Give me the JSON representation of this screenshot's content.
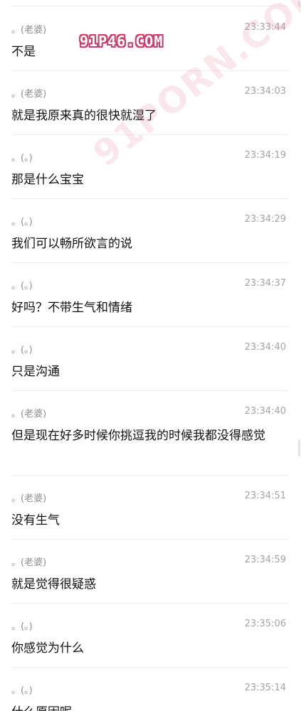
{
  "messages": [
    {
      "sender": "。(老婆)",
      "time": "23:33:44",
      "text": "不是"
    },
    {
      "sender": "。(老婆)",
      "time": "23:34:03",
      "text": "就是我原来真的很快就湿了"
    },
    {
      "sender": "。(。)",
      "time": "23:34:19",
      "text": "那是什么宝宝"
    },
    {
      "sender": "。(。)",
      "time": "23:34:29",
      "text": "我们可以畅所欲言的说"
    },
    {
      "sender": "。(。)",
      "time": "23:34:37",
      "text": "好吗？不带生气和情绪"
    },
    {
      "sender": "。(。)",
      "time": "23:34:40",
      "text": "只是沟通"
    },
    {
      "sender": "。(老婆)",
      "time": "23:34:40",
      "text": "但是现在好多时候你挑逗我的时候我都没得感觉"
    },
    {
      "sender": "。(老婆)",
      "time": "23:34:51",
      "text": "没有生气"
    },
    {
      "sender": "。(老婆)",
      "time": "23:34:59",
      "text": "就是觉得很疑惑"
    },
    {
      "sender": "。(。)",
      "time": "23:35:06",
      "text": "你感觉为什么"
    },
    {
      "sender": "。(。)",
      "time": "23:35:14",
      "text": "什么原因呢"
    }
  ],
  "watermark": {
    "top": "91P46.COM",
    "diagonal": "91PORN.COM"
  },
  "colors": {
    "sender": "#8e8e8e",
    "time": "#a4a4a4",
    "text": "#111111",
    "divider": "#ededed",
    "watermark_stroke": "#c93f6a"
  }
}
